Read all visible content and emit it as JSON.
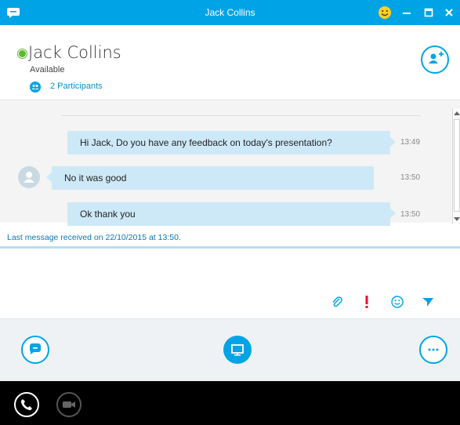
{
  "window": {
    "title": "Jack Collins"
  },
  "contact": {
    "name": "Jack Collins",
    "status": "Available",
    "participants_label": "2 Participants"
  },
  "messages": [
    {
      "text": "Hi Jack, Do you have any feedback on today's presentation?",
      "time": "13:49",
      "direction": "outgoing"
    },
    {
      "text": "No it was good",
      "time": "13:50",
      "direction": "incoming"
    },
    {
      "text": "Ok thank you",
      "time": "13:50",
      "direction": "outgoing"
    }
  ],
  "last_message_notice": "Last message received on 22/10/2015 at 13:50.",
  "compose": {
    "value": ""
  },
  "colors": {
    "accent": "#00a4e6",
    "bubble": "#cde9f7",
    "presence_available": "#5cb82f",
    "urgent": "#e8112d"
  },
  "icons": {
    "titlebar": [
      "chat-app-icon",
      "emoji-icon",
      "minimize-icon",
      "maximize-icon",
      "close-icon"
    ],
    "header": [
      "add-participant-icon",
      "participants-icon"
    ],
    "compose_tools": [
      "paperclip-icon",
      "exclamation-icon",
      "smiley-icon",
      "send-icon"
    ],
    "actions": [
      "im-icon",
      "present-screen-icon",
      "more-options-icon"
    ],
    "call": [
      "phone-icon",
      "video-camera-icon"
    ]
  }
}
